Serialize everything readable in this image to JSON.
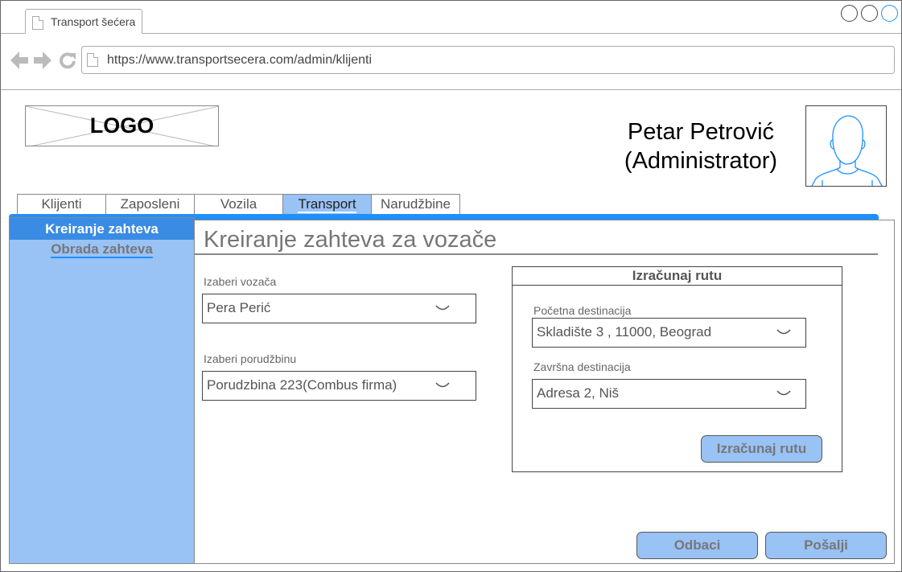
{
  "browser": {
    "tab_title": "Transport šećera",
    "url": "https://www.transportsecera.com/admin/klijenti",
    "icons": [
      "back-arrow-icon",
      "forward-arrow-icon",
      "reload-icon",
      "page-icon"
    ]
  },
  "header": {
    "logo_text": "LOGO",
    "user_name": "Petar Petrović",
    "user_role": "(Administrator)"
  },
  "main_tabs": [
    {
      "label": "Klijenti",
      "active": false
    },
    {
      "label": "Zaposleni",
      "active": false
    },
    {
      "label": "Vozila",
      "active": false
    },
    {
      "label": "Transport",
      "active": true
    },
    {
      "label": "Narudžbine",
      "active": false
    }
  ],
  "sidebar": {
    "items": [
      {
        "label": "Kreiranje zahteva",
        "active": true
      },
      {
        "label": "Obrada zahteva",
        "active": false
      }
    ]
  },
  "content": {
    "title": "Kreiranje zahteva za vozače",
    "driver": {
      "label": "Izaberi vozača",
      "value": "Pera Perić"
    },
    "order": {
      "label": "Izaberi porudžbinu",
      "value": "Porudzbina 223(Combus firma)"
    }
  },
  "route": {
    "header": "Izračunaj rutu",
    "start": {
      "label": "Početna destinacija",
      "value": "Skladište 3 , 11000, Beograd"
    },
    "end": {
      "label": "Završna destinacija",
      "value": "Adresa 2, Niš"
    },
    "button": "Izračunaj rutu"
  },
  "actions": {
    "reject": "Odbaci",
    "send": "Pošalji"
  },
  "colors": {
    "accent": "#1e90ff",
    "panel": "#99c2f5",
    "active_item": "#3a8be3"
  }
}
